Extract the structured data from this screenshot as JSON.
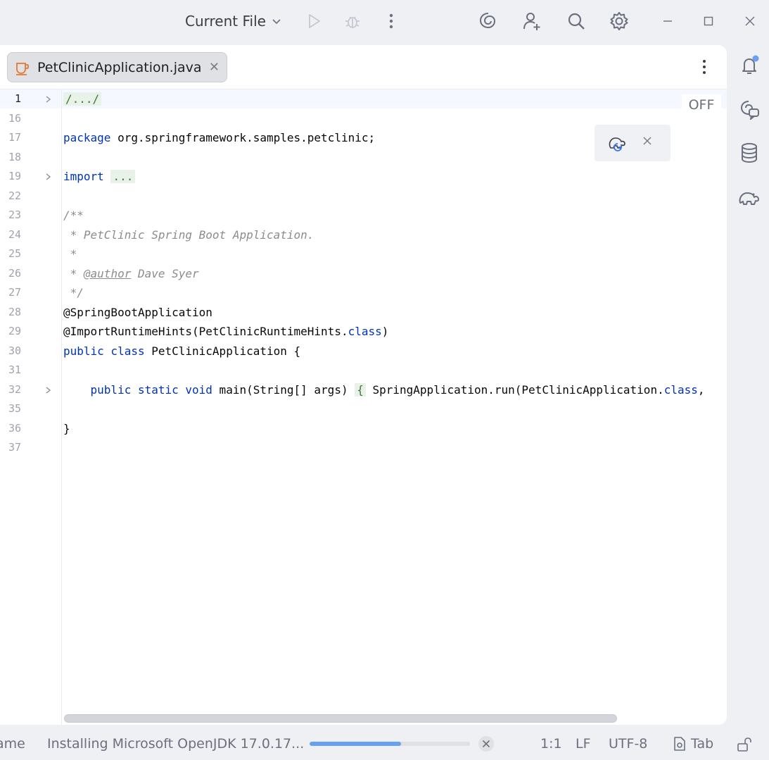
{
  "toolbar": {
    "run_config_label": "Current File",
    "icons": [
      "run-icon",
      "debug-icon",
      "more-vert-icon",
      "ai-assistant-icon",
      "add-user-icon",
      "search-icon",
      "settings-icon",
      "minimize-icon",
      "maximize-icon",
      "close-window-icon"
    ]
  },
  "editor": {
    "tab": {
      "label": "PetClinicApplication.java",
      "icon": "java-file-icon"
    },
    "off_label": "OFF",
    "lines": [
      {
        "num": "1",
        "tokens": [
          {
            "t": "/.../",
            "c": "folded"
          }
        ],
        "fold": true,
        "active": true
      },
      {
        "num": "16",
        "tokens": []
      },
      {
        "num": "17",
        "tokens": [
          {
            "t": "package",
            "c": "kw"
          },
          {
            "t": " org.springframework.samples.petclinic;",
            "c": ""
          }
        ]
      },
      {
        "num": "18",
        "tokens": []
      },
      {
        "num": "19",
        "tokens": [
          {
            "t": "import",
            "c": "kw"
          },
          {
            "t": " ",
            "c": ""
          },
          {
            "t": "...",
            "c": "folded"
          }
        ],
        "fold": true
      },
      {
        "num": "22",
        "tokens": []
      },
      {
        "num": "23",
        "tokens": [
          {
            "t": "/**",
            "c": "cm"
          }
        ]
      },
      {
        "num": "24",
        "tokens": [
          {
            "t": " * PetClinic Spring Boot Application.",
            "c": "cm"
          }
        ]
      },
      {
        "num": "25",
        "tokens": [
          {
            "t": " *",
            "c": "cm"
          }
        ]
      },
      {
        "num": "26",
        "tokens": [
          {
            "t": " * ",
            "c": "cm"
          },
          {
            "t": "@author",
            "c": "cm tag"
          },
          {
            "t": " Dave Syer",
            "c": "cm"
          }
        ]
      },
      {
        "num": "27",
        "tokens": [
          {
            "t": " */",
            "c": "cm"
          }
        ]
      },
      {
        "num": "28",
        "tokens": [
          {
            "t": "@SpringBootApplication",
            "c": ""
          }
        ]
      },
      {
        "num": "29",
        "tokens": [
          {
            "t": "@ImportRuntimeHints(PetClinicRuntimeHints.",
            "c": ""
          },
          {
            "t": "class",
            "c": "kw"
          },
          {
            "t": ")",
            "c": ""
          }
        ]
      },
      {
        "num": "30",
        "tokens": [
          {
            "t": "public class",
            "c": "kw"
          },
          {
            "t": " PetClinicApplication {",
            "c": ""
          }
        ]
      },
      {
        "num": "31",
        "tokens": []
      },
      {
        "num": "32",
        "tokens": [
          {
            "t": "    ",
            "c": ""
          },
          {
            "t": "public static void",
            "c": "kw"
          },
          {
            "t": " main(String[] args) ",
            "c": ""
          },
          {
            "t": "{",
            "c": "folded"
          },
          {
            "t": " SpringApplication.run(PetClinicApplication.",
            "c": ""
          },
          {
            "t": "class",
            "c": "kw"
          },
          {
            "t": ",",
            "c": ""
          }
        ],
        "fold": true
      },
      {
        "num": "35",
        "tokens": []
      },
      {
        "num": "36",
        "tokens": [
          {
            "t": "}",
            "c": ""
          }
        ]
      },
      {
        "num": "37",
        "tokens": []
      }
    ]
  },
  "right_strip": [
    "notifications-icon",
    "ai-chat-icon",
    "database-icon",
    "gradle-icon"
  ],
  "status_bar": {
    "left_cut": "ame",
    "task": "Installing Microsoft OpenJDK 17.0.17...",
    "progress": 0.57,
    "position": "1:1",
    "line_sep": "LF",
    "encoding": "UTF-8",
    "indent": "Tab"
  }
}
